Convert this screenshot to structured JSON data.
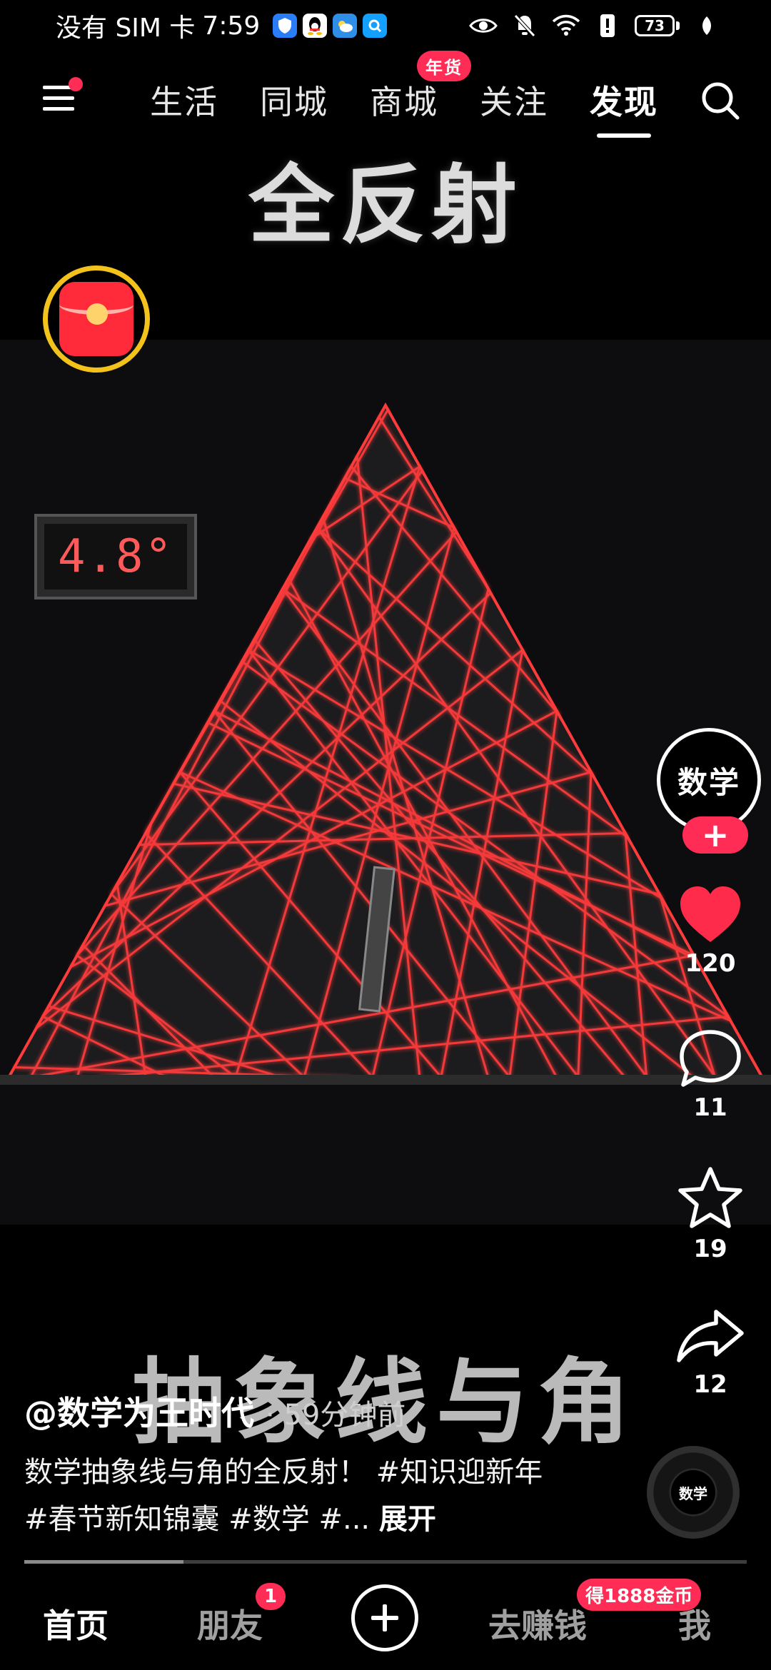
{
  "status_bar": {
    "carrier": "没有 SIM 卡",
    "time": "7:59",
    "battery": "73",
    "app_icons": [
      "shield-icon",
      "qq-icon",
      "weather-icon",
      "search-app-icon"
    ]
  },
  "top_nav": {
    "tabs": [
      {
        "label": "生活",
        "active": false
      },
      {
        "label": "同城",
        "active": false
      },
      {
        "label": "商城",
        "active": false,
        "badge": "年货"
      },
      {
        "label": "关注",
        "active": false
      },
      {
        "label": "发现",
        "active": true
      }
    ]
  },
  "video": {
    "title_overlay": "全反射",
    "temperature": "4.8°",
    "caption_overlay": "抽象线与角",
    "laser_color": "#ff3b3b",
    "progress_percent": 22
  },
  "author": {
    "handle": "@数学为王时代",
    "time": "· 59分钟前",
    "avatar_text": "数学"
  },
  "description": {
    "text": "数学抽象线与角的全反射！ #知识迎新年 #春节新知锦囊 #数学 #...",
    "expand": "展开"
  },
  "actions": {
    "likes": "120",
    "comments": "11",
    "favorites": "19",
    "shares": "12"
  },
  "music": {
    "label": "数学"
  },
  "bottom_nav": {
    "home": "首页",
    "friends": "朋友",
    "friends_badge": "1",
    "earn": "去赚钱",
    "earn_badge": "得1888金币",
    "me": "我"
  },
  "colors": {
    "accent": "#ff2d55",
    "ring": "#f3c21b"
  }
}
